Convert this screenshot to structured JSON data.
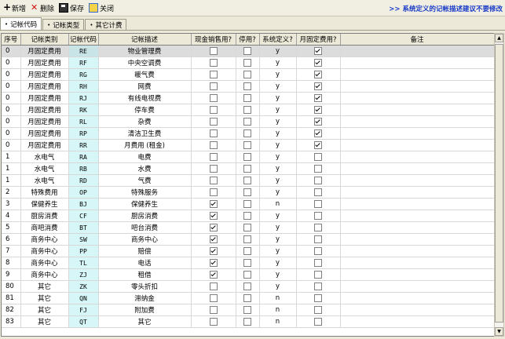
{
  "toolbar": {
    "new_label": "新增",
    "delete_label": "删除",
    "save_label": "保存",
    "close_label": "关闭",
    "notice": ">>  系统定义的记帐描述建议不要修改"
  },
  "tabs": [
    {
      "label": "记帐代码",
      "active": true
    },
    {
      "label": "记帐类型",
      "active": false
    },
    {
      "label": "其它计费",
      "active": false
    }
  ],
  "columns": [
    "序号",
    "记帐类别",
    "记帐代码",
    "记帐描述",
    "现金销售用?",
    "停用?",
    "系统定义?",
    "月固定费用?",
    "备注"
  ],
  "rows": [
    {
      "seq": "0",
      "category": "月固定费用",
      "code": "RE",
      "desc": "物业管理费",
      "cash": false,
      "disabled": false,
      "sys": "y",
      "monthly": true,
      "note": "",
      "selected": true
    },
    {
      "seq": "0",
      "category": "月固定费用",
      "code": "RF",
      "desc": "中央空调费",
      "cash": false,
      "disabled": false,
      "sys": "y",
      "monthly": true,
      "note": ""
    },
    {
      "seq": "0",
      "category": "月固定费用",
      "code": "RG",
      "desc": "暖气费",
      "cash": false,
      "disabled": false,
      "sys": "y",
      "monthly": true,
      "note": ""
    },
    {
      "seq": "0",
      "category": "月固定费用",
      "code": "RH",
      "desc": "网费",
      "cash": false,
      "disabled": false,
      "sys": "y",
      "monthly": true,
      "note": ""
    },
    {
      "seq": "0",
      "category": "月固定费用",
      "code": "RJ",
      "desc": "有线电视费",
      "cash": false,
      "disabled": false,
      "sys": "y",
      "monthly": true,
      "note": ""
    },
    {
      "seq": "0",
      "category": "月固定费用",
      "code": "RK",
      "desc": "停车费",
      "cash": false,
      "disabled": false,
      "sys": "y",
      "monthly": true,
      "note": ""
    },
    {
      "seq": "0",
      "category": "月固定费用",
      "code": "RL",
      "desc": "杂费",
      "cash": false,
      "disabled": false,
      "sys": "y",
      "monthly": true,
      "note": ""
    },
    {
      "seq": "0",
      "category": "月固定费用",
      "code": "RP",
      "desc": "清洁卫生费",
      "cash": false,
      "disabled": false,
      "sys": "y",
      "monthly": true,
      "note": ""
    },
    {
      "seq": "0",
      "category": "月固定费用",
      "code": "RR",
      "desc": "月费用 (租金)",
      "cash": false,
      "disabled": false,
      "sys": "y",
      "monthly": true,
      "note": ""
    },
    {
      "seq": "1",
      "category": "水电气",
      "code": "RA",
      "desc": "电费",
      "cash": false,
      "disabled": false,
      "sys": "y",
      "monthly": false,
      "note": ""
    },
    {
      "seq": "1",
      "category": "水电气",
      "code": "RB",
      "desc": "水费",
      "cash": false,
      "disabled": false,
      "sys": "y",
      "monthly": false,
      "note": ""
    },
    {
      "seq": "1",
      "category": "水电气",
      "code": "RD",
      "desc": "气费",
      "cash": false,
      "disabled": false,
      "sys": "y",
      "monthly": false,
      "note": ""
    },
    {
      "seq": "2",
      "category": "特殊费用",
      "code": "OP",
      "desc": "特殊服务",
      "cash": false,
      "disabled": false,
      "sys": "y",
      "monthly": false,
      "note": ""
    },
    {
      "seq": "3",
      "category": "保健养生",
      "code": "BJ",
      "desc": "保健养生",
      "cash": true,
      "disabled": false,
      "sys": "n",
      "monthly": false,
      "note": ""
    },
    {
      "seq": "4",
      "category": "厨房消费",
      "code": "CF",
      "desc": "厨房消费",
      "cash": true,
      "disabled": false,
      "sys": "y",
      "monthly": false,
      "note": ""
    },
    {
      "seq": "5",
      "category": "商吧消费",
      "code": "BT",
      "desc": "吧台消费",
      "cash": true,
      "disabled": false,
      "sys": "y",
      "monthly": false,
      "note": ""
    },
    {
      "seq": "6",
      "category": "商务中心",
      "code": "SW",
      "desc": "商务中心",
      "cash": true,
      "disabled": false,
      "sys": "y",
      "monthly": false,
      "note": ""
    },
    {
      "seq": "7",
      "category": "商务中心",
      "code": "PP",
      "desc": "赔偿",
      "cash": true,
      "disabled": false,
      "sys": "y",
      "monthly": false,
      "note": ""
    },
    {
      "seq": "8",
      "category": "商务中心",
      "code": "TL",
      "desc": "电话",
      "cash": true,
      "disabled": false,
      "sys": "y",
      "monthly": false,
      "note": ""
    },
    {
      "seq": "9",
      "category": "商务中心",
      "code": "ZJ",
      "desc": "租借",
      "cash": true,
      "disabled": false,
      "sys": "y",
      "monthly": false,
      "note": ""
    },
    {
      "seq": "80",
      "category": "其它",
      "code": "ZK",
      "desc": "零头折扣",
      "cash": false,
      "disabled": false,
      "sys": "y",
      "monthly": false,
      "note": ""
    },
    {
      "seq": "81",
      "category": "其它",
      "code": "QN",
      "desc": "滞纳金",
      "cash": false,
      "disabled": false,
      "sys": "n",
      "monthly": false,
      "note": ""
    },
    {
      "seq": "82",
      "category": "其它",
      "code": "FJ",
      "desc": "附加费",
      "cash": false,
      "disabled": false,
      "sys": "n",
      "monthly": false,
      "note": ""
    },
    {
      "seq": "83",
      "category": "其它",
      "code": "QT",
      "desc": "其它",
      "cash": false,
      "disabled": false,
      "sys": "n",
      "monthly": false,
      "note": ""
    }
  ]
}
